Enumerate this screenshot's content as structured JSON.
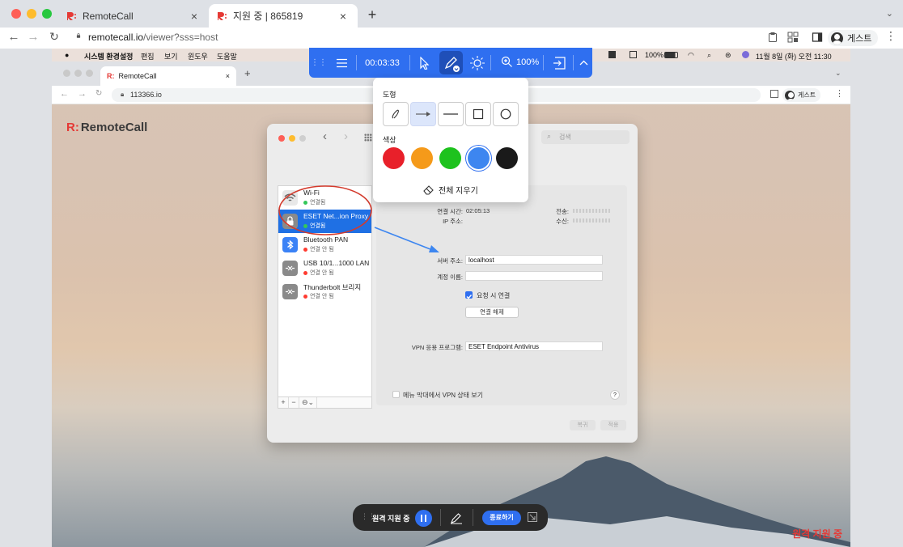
{
  "browser": {
    "tabs": [
      {
        "title": "RemoteCall",
        "close": "×"
      },
      {
        "title": "지원 중 | 865819",
        "close": "×"
      }
    ],
    "new_tab": "+",
    "tab_menu": "⌄",
    "url_host": "remotecall.io",
    "url_path": "/viewer?sss=host",
    "guest_label": "게스트",
    "kebab": "⋮"
  },
  "remote": {
    "menubar": {
      "apple": "",
      "items": [
        "시스템 환경설정",
        "편집",
        "보기",
        "윈도우",
        "도움말"
      ],
      "battery": "100%",
      "datetime": "11월 8일 (화) 오전 11:30"
    },
    "inner_browser": {
      "tab_title": "RemoteCall",
      "tab_close": "×",
      "new_tab": "+",
      "url": "113366.io",
      "guest_label": "게스트"
    },
    "brand": {
      "mark": "R:",
      "name": "RemoteCall"
    },
    "prefs": {
      "search_placeholder": "검색",
      "services": [
        {
          "name": "Wi-Fi",
          "status": "연결됨",
          "status_color": "#34c759"
        },
        {
          "name": "ESET Net...ion Proxy",
          "status": "연결됨",
          "status_color": "#34c759"
        },
        {
          "name": "Bluetooth PAN",
          "status": "연결 안 됨",
          "status_color": "#ff3b30"
        },
        {
          "name": "USB 10/1...1000 LAN",
          "status": "연결 안 됨",
          "status_color": "#ff3b30"
        },
        {
          "name": "Thunderbolt 브리지",
          "status": "연결 안 됨",
          "status_color": "#ff3b30"
        }
      ],
      "list_footer": [
        "+",
        "−",
        "⊖⌄"
      ],
      "connect_time_label": "연결 시간:",
      "connect_time": "02:05:13",
      "ip_label": "IP 주소:",
      "sent_label": "전송:",
      "recv_label": "수신:",
      "server_label": "서버 주소:",
      "server_value": "localhost",
      "account_label": "계정 이름:",
      "account_value": "",
      "on_demand_label": "요청 시 연결",
      "disconnect_label": "연결 해제",
      "vpn_app_label": "VPN 응용 프로그램:",
      "vpn_app_value": "ESET Endpoint Antivirus",
      "menubar_status_label": "메뉴 막대에서 VPN 상태 보기",
      "help": "?",
      "revert": "복귀",
      "apply": "적용"
    },
    "status_text": "원격 지원 중"
  },
  "toolbar": {
    "timer": "00:03:33",
    "zoom": "100%"
  },
  "draw_menu": {
    "shapes_label": "도형",
    "colors_label": "색상",
    "colors": [
      "#e8202a",
      "#f59a1a",
      "#1ec21e",
      "#3d86f0",
      "#1a1a1a"
    ],
    "selected_color": 3,
    "clear_all": "전체 지우기"
  },
  "bottom_bar": {
    "status": "원격 지원 중",
    "end": "종료하기"
  }
}
